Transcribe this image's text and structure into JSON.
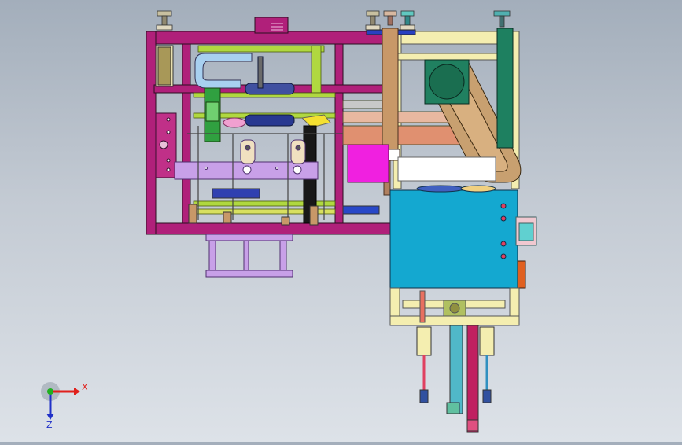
{
  "triad": {
    "x_label": "X",
    "z_label": "Z",
    "x_color": "#e0201c",
    "y_color": "#20b020",
    "z_color": "#2030c8"
  },
  "palette": {
    "frame_magenta": "#b0207a",
    "cover_cyan": "#14a8d0",
    "frame_cream": "#f4eeb0",
    "arm_tan": "#c89868",
    "plate_lilac": "#c8a0e8",
    "block_pink": "#f020e0",
    "belt_tan": "#c8a070",
    "rail_lime": "#b0d840",
    "roller_navy": "#283890"
  }
}
